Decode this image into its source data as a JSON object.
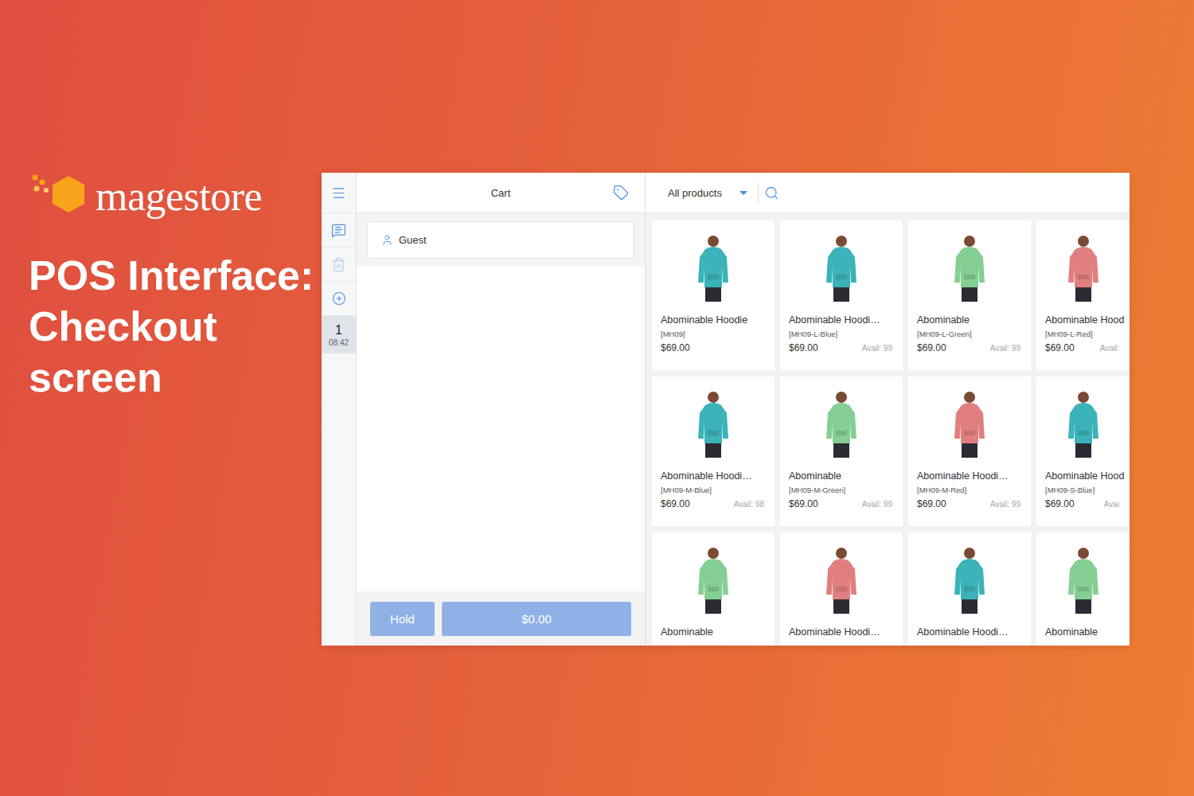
{
  "brand": {
    "name": "magestore"
  },
  "headline": [
    "POS Interface:",
    "Checkout",
    "screen"
  ],
  "session": {
    "number": "1",
    "time": "08:42",
    "selected": true
  },
  "cart": {
    "title": "Cart",
    "customer": "Guest",
    "hold_button": "Hold",
    "total_button": "$0.00"
  },
  "catalog": {
    "category": "All products",
    "products": [
      {
        "name": "Abominable Hoodie",
        "sku": "[MH09]",
        "price": "$69.00",
        "color": "#3bb3b8"
      },
      {
        "name": "Abominable Hoodi…",
        "sku": "[MH09-L-Blue]",
        "price": "$69.00",
        "avail": "Avail: 99",
        "color": "#3bb3b8"
      },
      {
        "name": "Abominable",
        "sku": "[MH09-L-Green]",
        "price": "$69.00",
        "avail": "Avail: 99",
        "color": "#86cf94"
      },
      {
        "name": "Abominable Hood",
        "sku": "[MH09-L-Red]",
        "price": "$69.00",
        "avail": "Avail:",
        "color": "#e17f80"
      },
      {
        "name": "Abominable Hoodi…",
        "sku": "[MH09-M-Blue]",
        "price": "$69.00",
        "avail": "Avail: 98",
        "color": "#3bb3b8"
      },
      {
        "name": "Abominable",
        "sku": "[MH09-M-Green]",
        "price": "$69.00",
        "avail": "Avail: 99",
        "color": "#86cf94"
      },
      {
        "name": "Abominable Hoodi…",
        "sku": "[MH09-M-Red]",
        "price": "$69.00",
        "avail": "Avail: 99",
        "color": "#e17f80"
      },
      {
        "name": "Abominable Hood",
        "sku": "[MH09-S-Blue]",
        "price": "$69.00",
        "avail": "Avai",
        "color": "#3bb3b8"
      },
      {
        "name": "Abominable",
        "color": "#86cf94"
      },
      {
        "name": "Abominable Hoodi…",
        "color": "#e17f80"
      },
      {
        "name": "Abominable Hoodi…",
        "color": "#3bb3b8"
      },
      {
        "name": "Abominable",
        "color": "#86cf94"
      }
    ]
  }
}
